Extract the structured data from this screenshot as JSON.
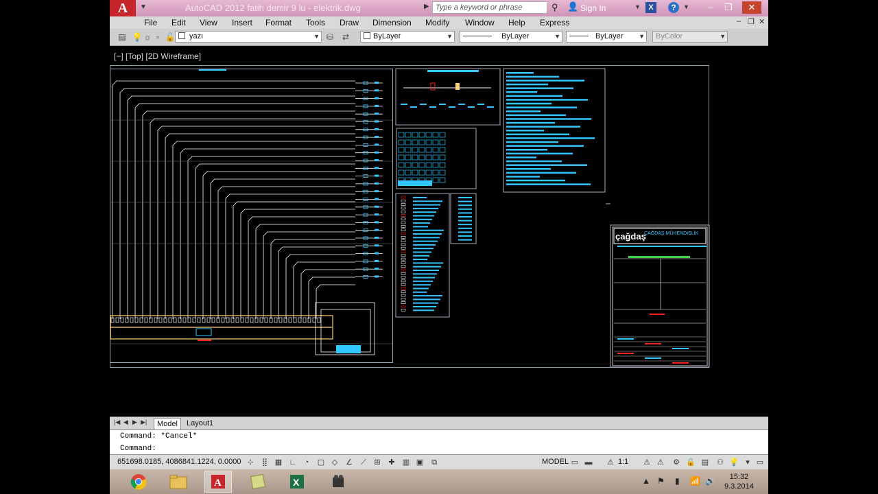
{
  "titlebar": {
    "app_button": "A",
    "title": "AutoCAD 2012    fatih demir 9 lu - elektrik.dwg",
    "search_placeholder": "Type a keyword or phrase",
    "signin": "Sign In",
    "help": "?",
    "minimize": "–",
    "restore": "❐",
    "close": "✕"
  },
  "menu": {
    "items": [
      "File",
      "Edit",
      "View",
      "Insert",
      "Format",
      "Tools",
      "Draw",
      "Dimension",
      "Modify",
      "Window",
      "Help",
      "Express"
    ]
  },
  "toolbar": {
    "layer_value": "yazı",
    "color_value": "ByLayer",
    "linetype_value": "ByLayer",
    "lineweight_value": "ByLayer",
    "plotstyle_value": "ByColor"
  },
  "viewport": {
    "label": "[−] [Top] [2D Wireframe]"
  },
  "title_block": {
    "logo_text": "çağdaş",
    "company": "ÇAĞDAŞ MÜHENDİSLİK"
  },
  "tabs": [
    "Model",
    "Layout1"
  ],
  "command": {
    "line1": "Command: *Cancel*",
    "line2": "Command:"
  },
  "status": {
    "coords": "651698.0185, 4086841.1224, 0.0000",
    "model": "MODEL",
    "scale": "1:1"
  },
  "clock": {
    "time": "15:32",
    "date": "9.3.2014"
  },
  "colors": {
    "titlebar": "#d9a8c5",
    "drawing_bg": "#000000",
    "line_white": "#ffffff",
    "line_cyan": "#33c7ff",
    "line_yellow": "#ffd27a",
    "line_red": "#ff2020"
  }
}
